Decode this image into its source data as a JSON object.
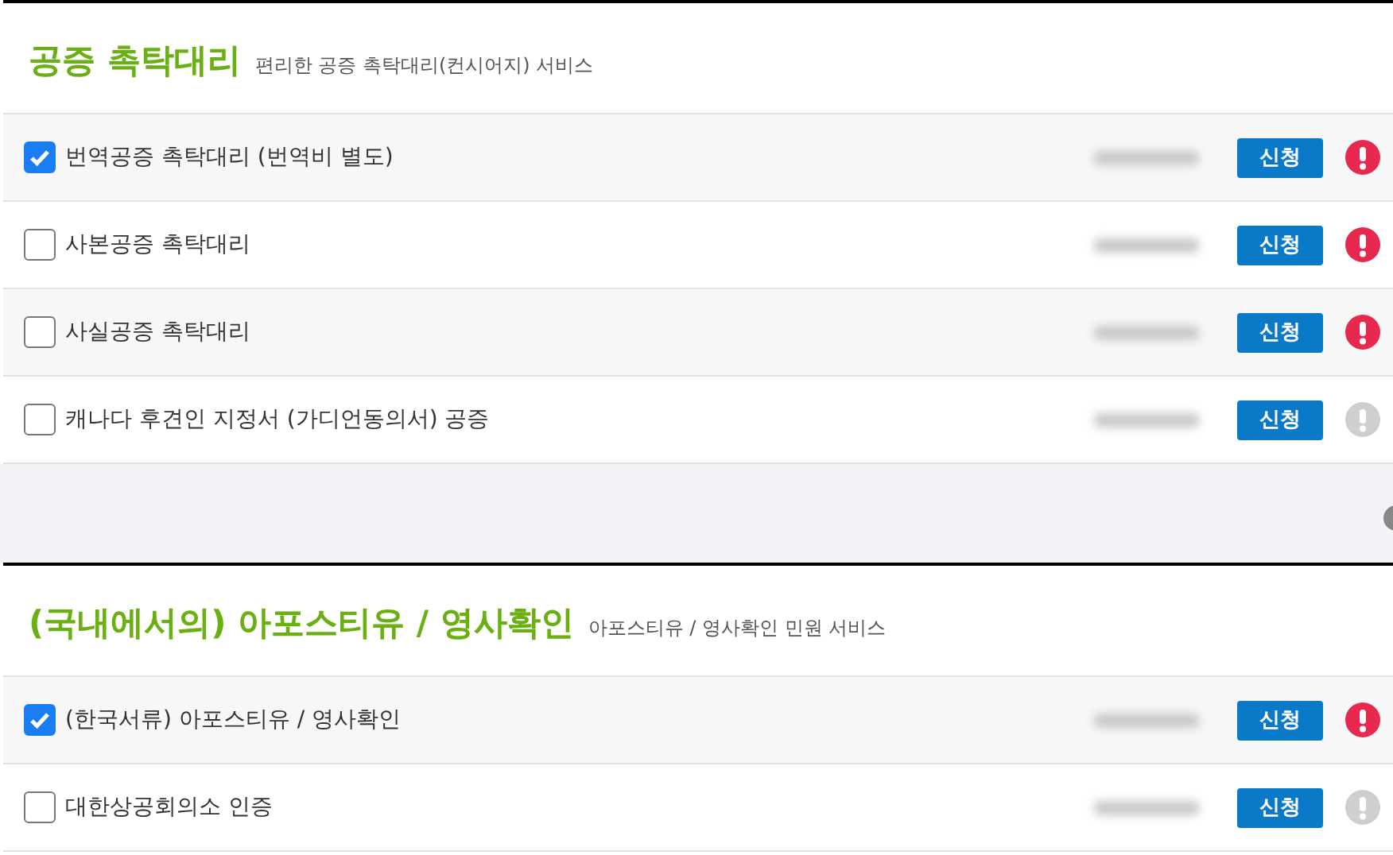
{
  "sections": [
    {
      "title": "공증 촉탁대리",
      "subtitle": "편리한 공증 촉탁대리(컨시어지) 서비스",
      "items": [
        {
          "label": "번역공증 촉탁대리 (번역비 별도)",
          "checked": true,
          "button": "신청",
          "alert_active": true
        },
        {
          "label": "사본공증 촉탁대리",
          "checked": false,
          "button": "신청",
          "alert_active": true
        },
        {
          "label": "사실공증 촉탁대리",
          "checked": false,
          "button": "신청",
          "alert_active": true
        },
        {
          "label": "캐나다 후견인 지정서 (가디언동의서) 공증",
          "checked": false,
          "button": "신청",
          "alert_active": false
        }
      ]
    },
    {
      "title": "(국내에서의) 아포스티유 / 영사확인",
      "subtitle": "아포스티유 / 영사확인 민원 서비스",
      "items": [
        {
          "label": "(한국서류) 아포스티유 / 영사확인",
          "checked": true,
          "button": "신청",
          "alert_active": true
        },
        {
          "label": "대한상공회의소 인증",
          "checked": false,
          "button": "신청",
          "alert_active": false
        }
      ]
    }
  ]
}
